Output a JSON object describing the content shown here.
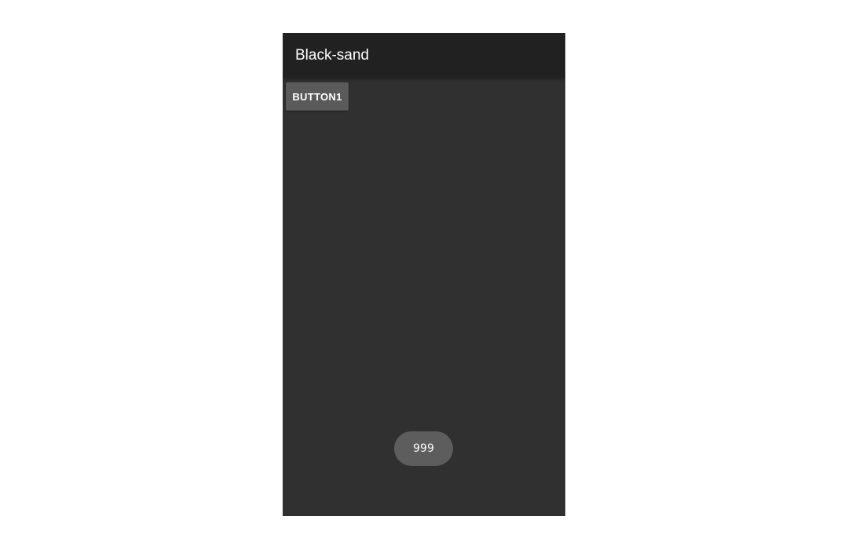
{
  "app": {
    "title": "Black-sand"
  },
  "main": {
    "button1_label": "BUTTON1"
  },
  "toast": {
    "text": "999"
  },
  "colors": {
    "app_bar": "#212121",
    "background": "#303030",
    "button": "#5a5a5a",
    "toast": "#5d5d5d",
    "text": "#ffffff"
  }
}
